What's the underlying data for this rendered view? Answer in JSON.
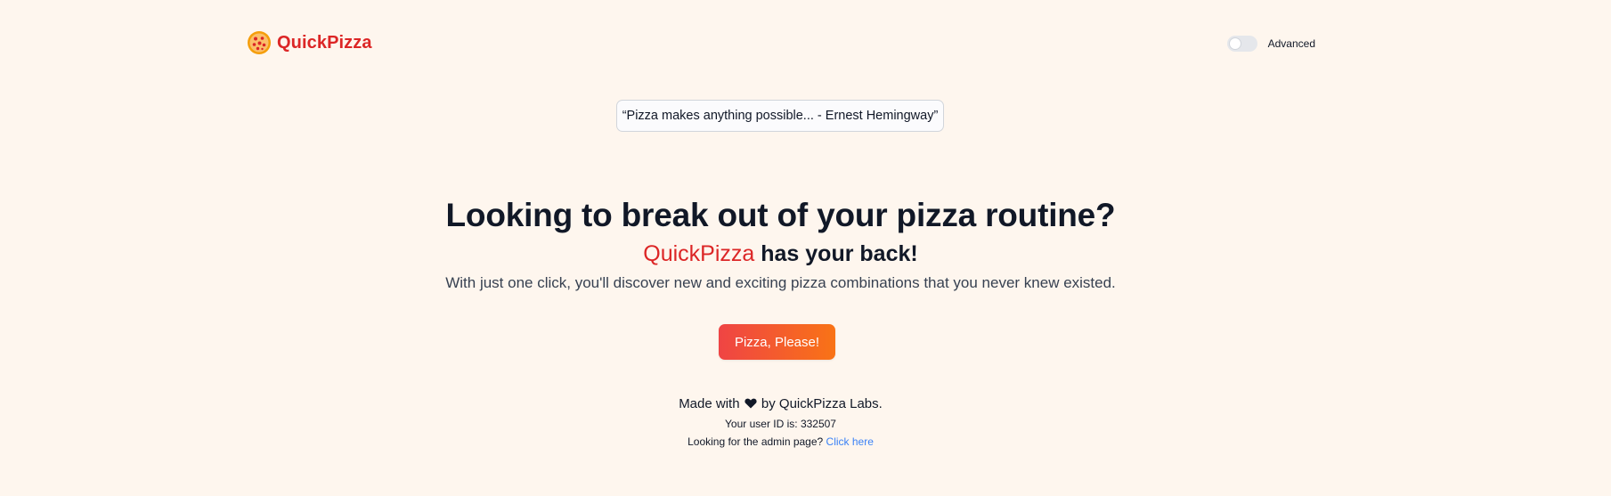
{
  "header": {
    "brand": "QuickPizza",
    "logo_icon": "pizza-icon",
    "toggle": {
      "label": "Advanced",
      "on": false
    }
  },
  "quote": {
    "text": "“Pizza makes anything possible... - Ernest Hemingway”"
  },
  "hero": {
    "title": "Looking to break out of your pizza routine?",
    "subtitle_brand": "QuickPizza",
    "subtitle_rest": " has your back!",
    "description": "With just one click, you'll discover new and exciting pizza combinations that you never knew existed."
  },
  "cta": {
    "label": "Pizza, Please!"
  },
  "footer": {
    "made_prefix": "Made with ",
    "heart_icon": "heart-icon",
    "made_suffix": " by QuickPizza Labs.",
    "user_id_text": "Your user ID is: 332507",
    "admin_prompt": "Looking for the admin page? ",
    "admin_link": "Click here"
  },
  "colors": {
    "background": "#fef6ee",
    "brand_red": "#dc2626",
    "cta_gradient_start": "#ef4444",
    "cta_gradient_end": "#f97316",
    "link_blue": "#3b82f6"
  }
}
